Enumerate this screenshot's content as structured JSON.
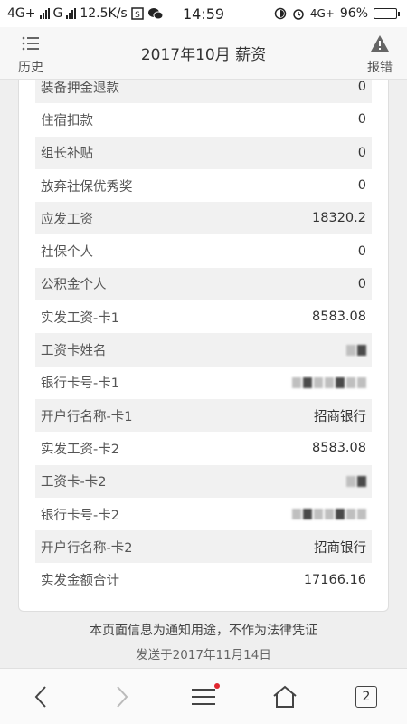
{
  "status_bar": {
    "network1": "4G+",
    "network2": "G",
    "speed": "12.5K/s",
    "time": "14:59",
    "network3": "4G+",
    "battery": "96%",
    "battery_level": 0.96
  },
  "header": {
    "history_label": "历史",
    "title": "2017年10月 薪资",
    "report_label": "报错"
  },
  "salary_rows": [
    {
      "label": "装备押金退款",
      "value": "0"
    },
    {
      "label": "住宿扣款",
      "value": "0"
    },
    {
      "label": "组长补贴",
      "value": "0"
    },
    {
      "label": "放弃社保优秀奖",
      "value": "0"
    },
    {
      "label": "应发工资",
      "value": "18320.2"
    },
    {
      "label": "社保个人",
      "value": "0"
    },
    {
      "label": "公积金个人",
      "value": "0"
    },
    {
      "label": "实发工资-卡1",
      "value": "8583.08"
    },
    {
      "label": "工资卡姓名",
      "value": ""
    },
    {
      "label": "银行卡号-卡1",
      "value": ""
    },
    {
      "label": "开户行名称-卡1",
      "value": "招商银行"
    },
    {
      "label": "实发工资-卡2",
      "value": "8583.08"
    },
    {
      "label": "工资卡-卡2",
      "value": ""
    },
    {
      "label": "银行卡号-卡2",
      "value": ""
    },
    {
      "label": "开户行名称-卡2",
      "value": "招商银行"
    },
    {
      "label": "实发金额合计",
      "value": "17166.16"
    }
  ],
  "notice": {
    "line1": "本页面信息为通知用途，不作为法律凭证",
    "line2": "发送于2017年11月14日"
  },
  "bottom_nav": {
    "tab_count": "2",
    "icons": [
      "back-icon",
      "forward-icon",
      "menu-icon",
      "home-icon",
      "tabs-icon"
    ],
    "badge_color": "#e0262e"
  }
}
